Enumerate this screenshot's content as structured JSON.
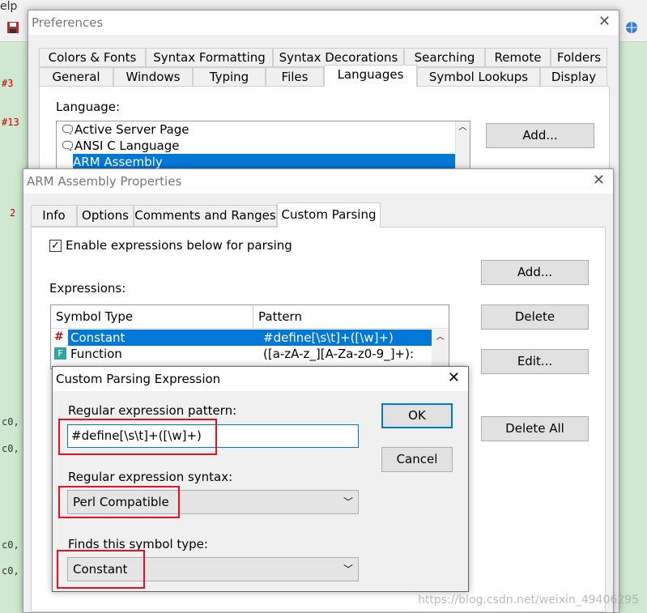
{
  "background": {
    "menu_fragment": "elp",
    "gutter_numbers": [
      "#3",
      "#13",
      "2"
    ],
    "code_fragments": [
      "c0,",
      "c0,",
      "c0,",
      "c0,"
    ]
  },
  "preferences": {
    "title": "Preferences",
    "tabs_row1": [
      "Colors & Fonts",
      "Syntax Formatting",
      "Syntax Decorations",
      "Searching",
      "Remote",
      "Folders"
    ],
    "tabs_row2": [
      "General",
      "Windows",
      "Typing",
      "Files",
      "Languages",
      "Symbol Lookups",
      "Display"
    ],
    "active_tab": "Languages",
    "language_label": "Language:",
    "languages": [
      "Active Server Page",
      "ANSI C Language",
      "ARM Assembly"
    ],
    "selected_language": "ARM Assembly",
    "add_button": "Add..."
  },
  "arm_props": {
    "title": "ARM Assembly Properties",
    "tabs": [
      "Info",
      "Options",
      "Comments and Ranges",
      "Custom Parsing"
    ],
    "active_tab": "Custom Parsing",
    "enable_checkbox": "Enable expressions below for parsing",
    "enable_checked": true,
    "expressions_label": "Expressions:",
    "columns": [
      "Symbol Type",
      "Pattern"
    ],
    "rows": [
      {
        "type": "Constant",
        "pattern": "#define[\\s\\t]+([\\w]+)"
      },
      {
        "type": "Function",
        "pattern": "([a-zA-z_][A-Za-z0-9_]+):"
      }
    ],
    "buttons": {
      "add": "Add...",
      "delete": "Delete",
      "edit": "Edit...",
      "delete_all": "Delete All"
    }
  },
  "custom_parsing": {
    "title": "Custom Parsing Expression",
    "pattern_label": "Regular expression pattern:",
    "pattern_value": "#define[\\s\\t]+([\\w]+)",
    "syntax_label": "Regular expression syntax:",
    "syntax_value": "Perl Compatible",
    "type_label": "Finds this symbol type:",
    "type_value": "Constant",
    "ok": "OK",
    "cancel": "Cancel"
  },
  "watermark": "https://blog.csdn.net/weixin_49406295",
  "colors": {
    "selection": "#0078d7",
    "highlight_box": "#e81123",
    "editor_bg": "#cfe8cf"
  }
}
